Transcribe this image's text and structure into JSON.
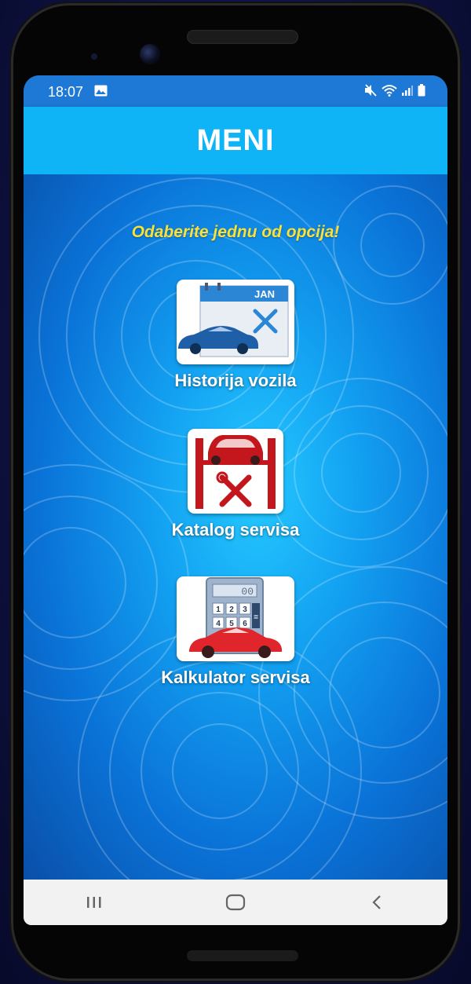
{
  "status_bar": {
    "time": "18:07",
    "left_icons": [
      "image-icon"
    ],
    "right_icons": [
      "mute-icon",
      "wifi-icon",
      "signal-icon",
      "battery-icon"
    ]
  },
  "app_bar": {
    "title": "MENI"
  },
  "prompt": "Odaberite jednu od opcija!",
  "menu": [
    {
      "label": "Historija vozila",
      "icon": "calendar-car-wrench-icon",
      "calendar_text": "JAN"
    },
    {
      "label": "Katalog servisa",
      "icon": "car-lift-tools-icon"
    },
    {
      "label": "Kalkulator servisa",
      "icon": "calculator-car-icon",
      "display_text": "00",
      "keys": [
        "1",
        "2",
        "3",
        "4",
        "5",
        "6"
      ],
      "side_key": "="
    }
  ],
  "nav_bar": {
    "buttons": [
      "recent-apps-icon",
      "home-icon",
      "back-icon"
    ]
  },
  "colors": {
    "status_bar": "#1d78d6",
    "app_bar": "#0fb4f6",
    "prompt_text": "#f8e23a",
    "nav_bar": "#f2f2f2"
  }
}
